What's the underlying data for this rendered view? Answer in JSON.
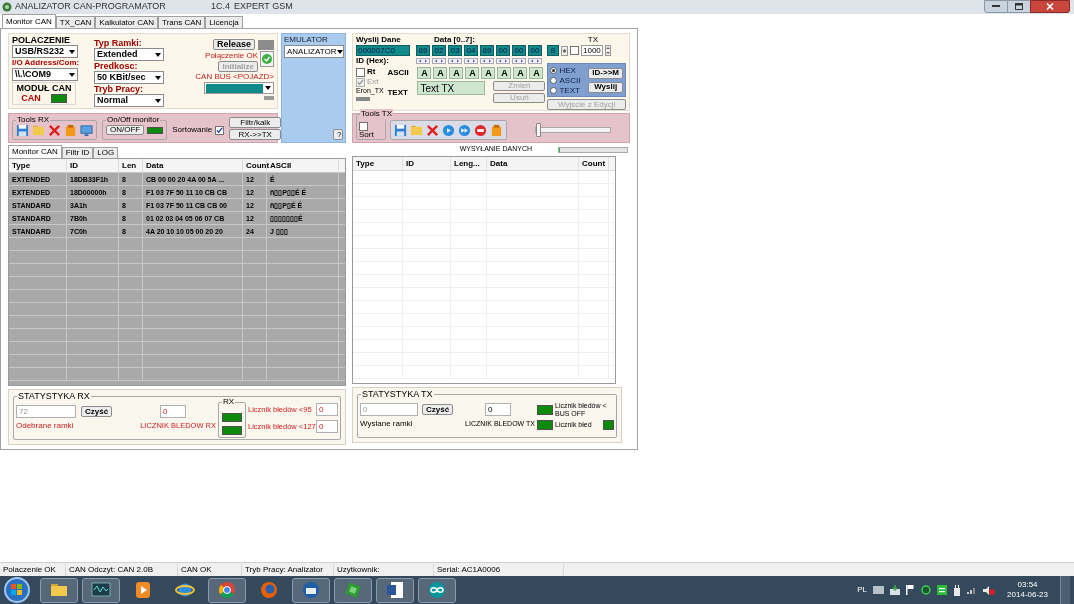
{
  "window": {
    "title": "ANALIZATOR CAN-PROGRAMATOR",
    "version": "1C.4",
    "edition": "EXPERT GSM"
  },
  "tabs": [
    {
      "label": "Monitor CAN",
      "selected": true
    },
    {
      "label": "TX_CAN",
      "selected": false
    },
    {
      "label": "Kalkulator CAN",
      "selected": false
    },
    {
      "label": "Trans CAN",
      "selected": false
    },
    {
      "label": "Licencja",
      "selected": false
    }
  ],
  "connection": {
    "heading": "POLACZENIE",
    "port_type": "USB/RS232",
    "address_label": "I/O Address/Com:",
    "address": "\\\\.\\COM9",
    "module_title": "MODUŁ CAN",
    "module_label": "CAN",
    "module_on": true
  },
  "frame": {
    "type_label": "Typ Ramki:",
    "type": "Extended",
    "speed_label": "Predkosc:",
    "speed": "50 KBit/sec",
    "mode_label": "Tryb Pracy:",
    "mode": "Normal"
  },
  "link": {
    "release_button": "Release",
    "status": "Połączenie OK",
    "initialize_button": "Initialize",
    "initialize_disabled": true,
    "bus_label": "CAN BUS <POJAZD>"
  },
  "emulator": {
    "title": "EMULATOR",
    "mode": "ANALIZATOR",
    "help_button": "?"
  },
  "tools_rx": {
    "title": "Tools RX",
    "monitor_title": "On/Off monitor",
    "toggle_button": "ON/OFF",
    "monitor_on": true,
    "sort_label": "Sortowanie",
    "sort_checked": true,
    "filter_button": "Filtr/kalk",
    "copy_button": "RX->>TX"
  },
  "send": {
    "title": "Wyslij Dane",
    "data_label": "Data [0..7]:",
    "tx_label": "TX",
    "id": "000007C0",
    "data": [
      "89",
      "02",
      "03",
      "04",
      "89",
      "00",
      "00",
      "00"
    ],
    "length": "8",
    "tx_checked": false,
    "interval": "1000",
    "id_label": "ID (Hex):",
    "rt": {
      "label": "Rt",
      "checked": false
    },
    "ext": {
      "label": "Ext",
      "checked": true,
      "disabled": true
    },
    "error_label": "Eron_TX",
    "ascii_label": "ASCII",
    "ascii": [
      "A",
      "A",
      "A",
      "A",
      "A",
      "A",
      "A",
      "A"
    ],
    "text_label": "TEXT",
    "text": "Text TX",
    "formats": [
      {
        "label": "HEX",
        "selected": true
      },
      {
        "label": "ASCII",
        "selected": false
      },
      {
        "label": "TEXT",
        "selected": false
      }
    ],
    "id_button": "ID->>M",
    "send_button": "Wyslij",
    "change_button": "Zmień",
    "remove_button": "Usuń",
    "exit_button": "Wyjscie z Edycji",
    "edit_buttons_disabled": true
  },
  "tools_tx": {
    "title": "Tools TX",
    "sort_label": "Sort",
    "sort_checked": false,
    "level": 0
  },
  "sending": {
    "label": "WYSYŁANIE DANYCH",
    "level": 0
  },
  "rx_tabs": [
    {
      "label": "Monitor CAN",
      "selected": true
    },
    {
      "label": "Filtr ID",
      "selected": false
    },
    {
      "label": "LOG",
      "selected": false
    }
  ],
  "rx_table": {
    "columns": [
      "Type",
      "ID",
      "Len",
      "Data",
      "Count",
      "ASCII"
    ],
    "rows": [
      [
        "EXTENDED",
        "18DB33F1h",
        "8",
        "CB 00 00 20 4A 00 5A ...",
        "12",
        "É"
      ],
      [
        "EXTENDED",
        "18D00000h",
        "8",
        "F1 03 7F 50 11 10 CB CB",
        "12",
        "ñ▯▯P▯▯É É"
      ],
      [
        "STANDARD",
        "3A1h",
        "8",
        "F1 03 7F 50 11 CB CB 00",
        "12",
        "ñ▯▯P▯É É"
      ],
      [
        "STANDARD",
        "7B0h",
        "8",
        "01 02 03 04 05 06 07 CB",
        "12",
        "▯▯▯▯▯▯▯É"
      ],
      [
        "STANDARD",
        "7C0h",
        "8",
        "4A 20 10 10 05 00 20 20",
        "24",
        "J  ▯▯▯"
      ]
    ]
  },
  "tx_table": {
    "columns": [
      "Type",
      "ID",
      "Leng...",
      "Data",
      "Count"
    ]
  },
  "rx_stats": {
    "title": "STATYSTYKA RX",
    "frames": "72",
    "clear_button": "Czyść",
    "frames_label": "Odebrane ramki",
    "errors": "0",
    "errors_label": "LICZNIK BLEDOW RX",
    "group_title": "RX",
    "counters": [
      {
        "label": "Licznik błedów <95",
        "value": "0",
        "on": true
      },
      {
        "label": "Licznik błedów <127",
        "value": "0",
        "on": true
      }
    ]
  },
  "tx_stats": {
    "title": "STATYSTYKA TX",
    "frames": "0",
    "clear_button": "Czyść",
    "frames_label": "Wyslane ramki",
    "errors": "0",
    "errors_label": "LICZNIK BLEDOW TX",
    "counters": [
      {
        "label": "Licznik błedów < BUS OFF",
        "on": true
      },
      {
        "label": "Licznik błed",
        "on": true
      }
    ],
    "trailing_indicator_on": true
  },
  "status_bar": [
    "Polaczenie OK",
    "CAN Odczyt: CAN 2.0B",
    "CAN OK",
    "Tryb Pracy: Analizator",
    "Uzytkownik:",
    "Serial: AC1A0006"
  ],
  "taskbar": {
    "apps": [
      {
        "kind": "explorer",
        "running": true
      },
      {
        "kind": "scope",
        "running": true
      },
      {
        "kind": "media",
        "running": false
      },
      {
        "kind": "ie",
        "running": false
      },
      {
        "kind": "chrome",
        "running": true
      },
      {
        "kind": "firefox",
        "running": false
      },
      {
        "kind": "mail",
        "running": true
      },
      {
        "kind": "chip",
        "running": true
      },
      {
        "kind": "word",
        "running": true
      },
      {
        "kind": "arduino",
        "running": true
      }
    ],
    "language": "PL",
    "time": "03:54",
    "date": "2014-06-23"
  }
}
